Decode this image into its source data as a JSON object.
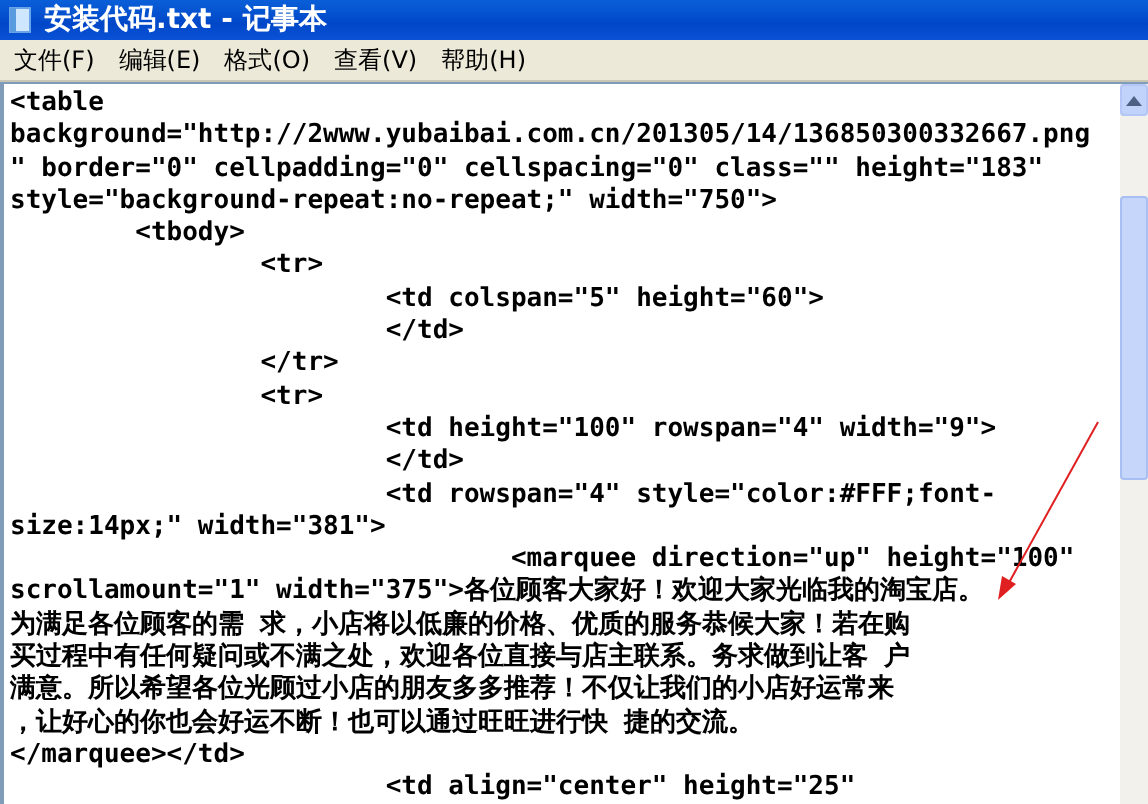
{
  "window": {
    "title": "安装代码.txt - 记事本"
  },
  "menu": [
    "文件(F)",
    "编辑(E)",
    "格式(O)",
    "查看(V)",
    "帮助(H)"
  ],
  "lines": [
    "<table",
    "background=\"http://2www.yubaibai.com.cn/201305/14/136850300332667.png",
    "\" border=\"0\" cellpadding=\"0\" cellspacing=\"0\" class=\"\" height=\"183\"",
    "style=\"background-repeat:no-repeat;\" width=\"750\">",
    "\t<tbody>",
    "\t\t<tr>",
    "\t\t\t<td colspan=\"5\" height=\"60\">",
    "\t\t\t</td>",
    "\t\t</tr>",
    "\t\t<tr>",
    "\t\t\t<td height=\"100\" rowspan=\"4\" width=\"9\">",
    "\t\t\t</td>",
    "\t\t\t<td rowspan=\"4\" style=\"color:#FFF;font-",
    "size:14px;\" width=\"381\">",
    "\t\t\t\t<marquee direction=\"up\" height=\"100\"",
    "scrollamount=\"1\" width=\"375\">各位顾客大家好！欢迎大家光临我的淘宝店。",
    "为满足各位顾客的需 求，小店将以低廉的价格、优质的服务恭候大家！若在购",
    "买过程中有任何疑问或不满之处，欢迎各位直接与店主联系。务求做到让客 户",
    "满意。所以希望各位光顾过小店的朋友多多推荐！不仅让我们的小店好运常来",
    "，让好心的你也会好运不断！也可以通过旺旺进行快 捷的交流。",
    "</marquee></td>",
    "\t\t\t<td align=\"center\" height=\"25\""
  ]
}
